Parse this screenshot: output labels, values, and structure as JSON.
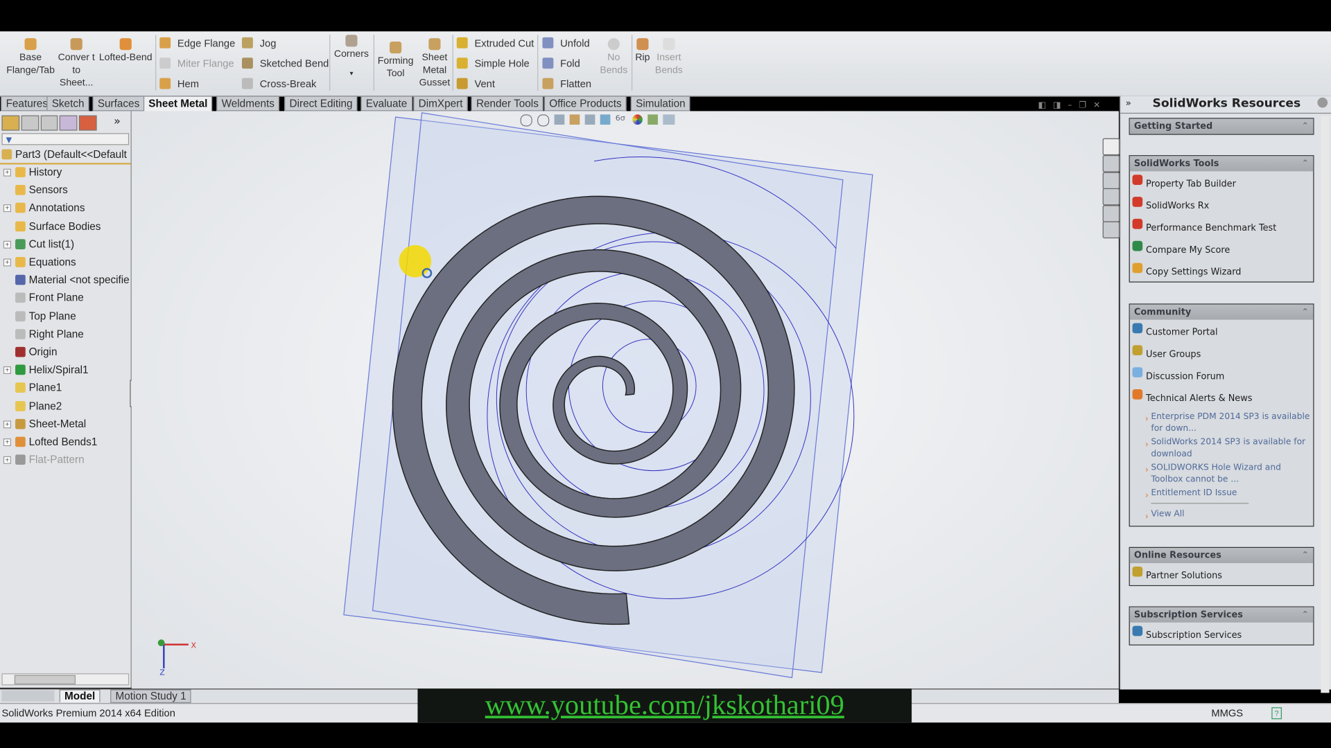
{
  "ribbon": {
    "large_buttons": [
      {
        "label": "Base Flange/Tab",
        "icon": "base-flange-icon"
      },
      {
        "label": "Conver t to Sheet...",
        "icon": "convert-to-sheet-icon"
      },
      {
        "label": "Lofted-Bend",
        "icon": "lofted-bend-icon"
      }
    ],
    "col1": [
      {
        "label": "Edge Flange",
        "enabled": true
      },
      {
        "label": "Miter Flange",
        "enabled": false
      },
      {
        "label": "Hem",
        "enabled": true
      }
    ],
    "col2": [
      {
        "label": "Jog",
        "enabled": true
      },
      {
        "label": "Sketched Bend",
        "enabled": true
      },
      {
        "label": "Cross-Break",
        "enabled": true
      }
    ],
    "corners": "Corners",
    "corners_arrow": "▾",
    "forming_tool": "Forming Tool",
    "gusset": "Sheet Metal Gusset",
    "col3": [
      {
        "label": "Extruded Cut",
        "enabled": true
      },
      {
        "label": "Simple Hole",
        "enabled": true
      },
      {
        "label": "Vent",
        "enabled": true
      }
    ],
    "col4": [
      {
        "label": "Unfold",
        "enabled": true
      },
      {
        "label": "Fold",
        "enabled": true
      },
      {
        "label": "Flatten",
        "enabled": true
      }
    ],
    "no_bends": "No Bends",
    "rip": "Rip",
    "insert_bends": "Insert Bends"
  },
  "tabs": [
    {
      "label": "Features",
      "active": false
    },
    {
      "label": "Sketch",
      "active": false
    },
    {
      "label": "Surfaces",
      "active": false
    },
    {
      "label": "Sheet Metal",
      "active": true
    },
    {
      "label": "Weldments",
      "active": false
    },
    {
      "label": "Direct Editing",
      "active": false
    },
    {
      "label": "Evaluate",
      "active": false
    },
    {
      "label": "DimXpert",
      "active": false
    },
    {
      "label": "Render Tools",
      "active": false
    },
    {
      "label": "Office Products",
      "active": false
    },
    {
      "label": "Simulation",
      "active": false
    }
  ],
  "tree": {
    "expand_arrow": "»",
    "root": "Part3  (Default<<Default",
    "items": [
      {
        "label": "History",
        "expand": true,
        "color": "#e8b84a"
      },
      {
        "label": "Sensors",
        "expand": false,
        "color": "#e8b84a"
      },
      {
        "label": "Annotations",
        "expand": true,
        "color": "#e8b84a"
      },
      {
        "label": "Surface Bodies",
        "expand": false,
        "color": "#e8b84a"
      },
      {
        "label": "Cut list(1)",
        "expand": true,
        "color": "#4a9a5a"
      },
      {
        "label": "Equations",
        "expand": true,
        "color": "#e8b84a"
      },
      {
        "label": "Material <not specifie",
        "expand": false,
        "color": "#5566aa"
      },
      {
        "label": "Front Plane",
        "expand": false,
        "color": "#bbbbbb"
      },
      {
        "label": "Top Plane",
        "expand": false,
        "color": "#bbbbbb"
      },
      {
        "label": "Right Plane",
        "expand": false,
        "color": "#bbbbbb"
      },
      {
        "label": "Origin",
        "expand": false,
        "color": "#a03030"
      },
      {
        "label": "Helix/Spiral1",
        "expand": true,
        "color": "#2f9a3f"
      },
      {
        "label": "Plane1",
        "expand": false,
        "color": "#e6c650"
      },
      {
        "label": "Plane2",
        "expand": false,
        "color": "#e6c650"
      },
      {
        "label": "Sheet-Metal",
        "expand": true,
        "color": "#c89a40"
      },
      {
        "label": "Lofted Bends1",
        "expand": true,
        "color": "#e0903a"
      },
      {
        "label": "Flat-Pattern",
        "expand": true,
        "color": "#999999",
        "disabled": true
      }
    ]
  },
  "resources": {
    "title": "SolidWorks Resources",
    "sections": [
      {
        "title": "Getting Started",
        "items": []
      },
      {
        "title": "SolidWorks Tools",
        "items": [
          {
            "label": "Property Tab Builder",
            "color": "#d23a2a"
          },
          {
            "label": "SolidWorks Rx",
            "color": "#d23a2a"
          },
          {
            "label": "Performance Benchmark Test",
            "color": "#d23a2a"
          },
          {
            "label": "Compare My Score",
            "color": "#2f8a4a"
          },
          {
            "label": "Copy Settings Wizard",
            "color": "#e0a030"
          }
        ]
      },
      {
        "title": "Community",
        "items": [
          {
            "label": "Customer Portal",
            "color": "#3a7ab0"
          },
          {
            "label": "User Groups",
            "color": "#c0a030"
          },
          {
            "label": "Discussion Forum",
            "color": "#7ab0e0"
          },
          {
            "label": "Technical Alerts & News",
            "color": "#e07a2a"
          }
        ],
        "news": [
          "Enterprise PDM 2014 SP3 is available for down...",
          "SolidWorks 2014 SP3 is available for download",
          "SOLIDWORKS Hole Wizard and Toolbox cannot be ...",
          "Entitlement ID Issue"
        ],
        "view_all": "View All"
      },
      {
        "title": "Online Resources",
        "items": [
          {
            "label": "Partner Solutions",
            "color": "#c0a030"
          }
        ]
      },
      {
        "title": "Subscription Services",
        "items": [
          {
            "label": "Subscription Services",
            "color": "#3a7ab0"
          }
        ]
      }
    ]
  },
  "bottom_tabs": [
    {
      "label": "Model",
      "active": true
    },
    {
      "label": "Motion Study 1",
      "active": false
    }
  ],
  "status": {
    "edition": "SolidWorks Premium 2014 x64 Edition",
    "units": "MMGS"
  },
  "watermark": "www.youtube.com/jkskothari09",
  "triad": {
    "x": "X",
    "z": "Z"
  },
  "colors": {
    "part": "#6b6f80",
    "sketch": "#3030c0",
    "plane": "#cdd8ee",
    "cursor": "#f5d800",
    "watermark": "#33c233"
  }
}
